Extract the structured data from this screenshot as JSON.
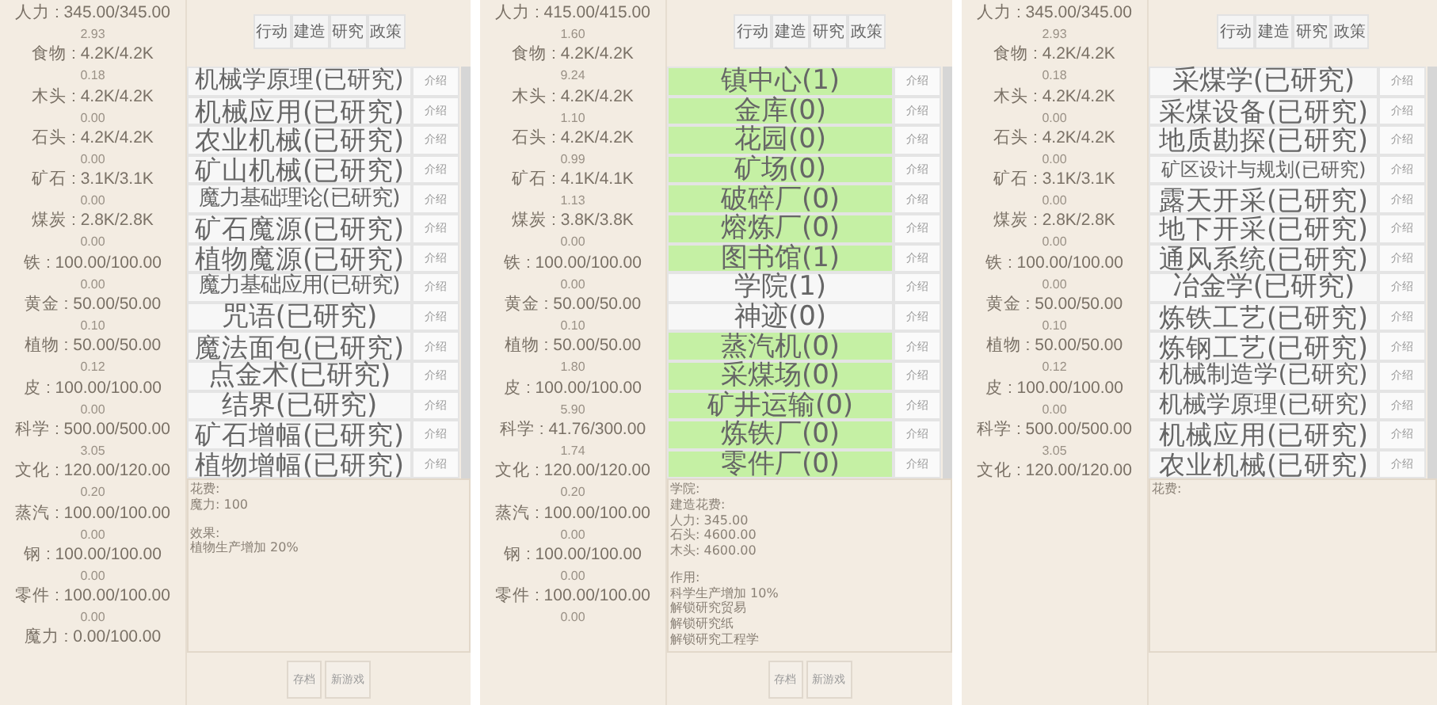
{
  "panels": [
    {
      "resources": [
        {
          "label": "人力 : 345.00/345.00",
          "rate": "2.93"
        },
        {
          "label": "食物 : 4.2K/4.2K",
          "rate": "0.18"
        },
        {
          "label": "木头 : 4.2K/4.2K",
          "rate": "0.00"
        },
        {
          "label": "石头 : 4.2K/4.2K",
          "rate": "0.00"
        },
        {
          "label": "矿石 : 3.1K/3.1K",
          "rate": "0.00"
        },
        {
          "label": "煤炭 : 2.8K/2.8K",
          "rate": "0.00"
        },
        {
          "label": "铁 : 100.00/100.00",
          "rate": "0.00"
        },
        {
          "label": "黄金 : 50.00/50.00",
          "rate": "0.10"
        },
        {
          "label": "植物 : 50.00/50.00",
          "rate": "0.12"
        },
        {
          "label": "皮 : 100.00/100.00",
          "rate": "0.00"
        },
        {
          "label": "科学 : 500.00/500.00",
          "rate": "3.05"
        },
        {
          "label": "文化 : 120.00/120.00",
          "rate": "0.20"
        },
        {
          "label": "蒸汽 : 100.00/100.00",
          "rate": "0.00"
        },
        {
          "label": "钢 : 100.00/100.00",
          "rate": "0.00"
        },
        {
          "label": "零件 : 100.00/100.00",
          "rate": "0.00"
        },
        {
          "label": "魔力 : 0.00/100.00"
        }
      ],
      "tabs": [
        "行动",
        "建造",
        "研究",
        "政策"
      ],
      "list": [
        {
          "name": "机械学原理(已研究)",
          "button": "介绍",
          "available": false
        },
        {
          "name": "机械应用(已研究)",
          "button": "介绍",
          "available": false
        },
        {
          "name": "农业机械(已研究)",
          "button": "介绍",
          "available": false
        },
        {
          "name": "矿山机械(已研究)",
          "button": "介绍",
          "available": false
        },
        {
          "name": "魔力基础理论(已研究)",
          "button": "介绍",
          "available": false
        },
        {
          "name": "矿石魔源(已研究)",
          "button": "介绍",
          "available": false
        },
        {
          "name": "植物魔源(已研究)",
          "button": "介绍",
          "available": false
        },
        {
          "name": "魔力基础应用(已研究)",
          "button": "介绍",
          "available": false
        },
        {
          "name": "咒语(已研究)",
          "button": "介绍",
          "available": false
        },
        {
          "name": "魔法面包(已研究)",
          "button": "介绍",
          "available": false
        },
        {
          "name": "点金术(已研究)",
          "button": "介绍",
          "available": false
        },
        {
          "name": "结界(已研究)",
          "button": "介绍",
          "available": false
        },
        {
          "name": "矿石增幅(已研究)",
          "button": "介绍",
          "available": false
        },
        {
          "name": "植物增幅(已研究)",
          "button": "介绍",
          "available": false
        }
      ],
      "details": [
        [
          "花费:",
          "魔力: 100"
        ],
        [
          "效果:",
          "植物生产增加 20%"
        ]
      ],
      "footer_buttons": [
        "存档",
        "新游戏"
      ]
    },
    {
      "resources": [
        {
          "label": "人力 : 415.00/415.00",
          "rate": "1.60"
        },
        {
          "label": "食物 : 4.2K/4.2K",
          "rate": "9.24"
        },
        {
          "label": "木头 : 4.2K/4.2K",
          "rate": "1.10"
        },
        {
          "label": "石头 : 4.2K/4.2K",
          "rate": "0.99"
        },
        {
          "label": "矿石 : 4.1K/4.1K",
          "rate": "1.13"
        },
        {
          "label": "煤炭 : 3.8K/3.8K",
          "rate": "0.00"
        },
        {
          "label": "铁 : 100.00/100.00",
          "rate": "0.00"
        },
        {
          "label": "黄金 : 50.00/50.00",
          "rate": "0.10"
        },
        {
          "label": "植物 : 50.00/50.00",
          "rate": "1.80"
        },
        {
          "label": "皮 : 100.00/100.00",
          "rate": "5.90"
        },
        {
          "label": "科学 : 41.76/300.00",
          "rate": "1.74"
        },
        {
          "label": "文化 : 120.00/120.00",
          "rate": "0.20"
        },
        {
          "label": "蒸汽 : 100.00/100.00",
          "rate": "0.00"
        },
        {
          "label": "钢 : 100.00/100.00",
          "rate": "0.00"
        },
        {
          "label": "零件 : 100.00/100.00",
          "rate": "0.00"
        }
      ],
      "tabs": [
        "行动",
        "建造",
        "研究",
        "政策"
      ],
      "list": [
        {
          "name": "镇中心(1)",
          "button": "介绍",
          "available": true
        },
        {
          "name": "金库(0)",
          "button": "介绍",
          "available": true
        },
        {
          "name": "花园(0)",
          "button": "介绍",
          "available": true
        },
        {
          "name": "矿场(0)",
          "button": "介绍",
          "available": true
        },
        {
          "name": "破碎厂(0)",
          "button": "介绍",
          "available": true
        },
        {
          "name": "熔炼厂(0)",
          "button": "介绍",
          "available": true
        },
        {
          "name": "图书馆(1)",
          "button": "介绍",
          "available": true
        },
        {
          "name": "学院(1)",
          "button": "介绍",
          "available": false
        },
        {
          "name": "神迹(0)",
          "button": "介绍",
          "available": false
        },
        {
          "name": "蒸汽机(0)",
          "button": "介绍",
          "available": true
        },
        {
          "name": "采煤场(0)",
          "button": "介绍",
          "available": true
        },
        {
          "name": "矿井运输(0)",
          "button": "介绍",
          "available": true
        },
        {
          "name": "炼铁厂(0)",
          "button": "介绍",
          "available": true
        },
        {
          "name": "零件厂(0)",
          "button": "介绍",
          "available": true
        }
      ],
      "details": [
        [
          "学院:",
          "建造花费:",
          "人力: 345.00",
          "石头: 4600.00",
          "木头: 4600.00"
        ],
        [
          "作用:",
          "科学生产增加 10%",
          "解锁研究贸易",
          "解锁研究纸",
          "解锁研究工程学"
        ]
      ],
      "footer_buttons": [
        "存档",
        "新游戏"
      ]
    },
    {
      "resources": [
        {
          "label": "人力 : 345.00/345.00",
          "rate": "2.93"
        },
        {
          "label": "食物 : 4.2K/4.2K",
          "rate": "0.18"
        },
        {
          "label": "木头 : 4.2K/4.2K",
          "rate": "0.00"
        },
        {
          "label": "石头 : 4.2K/4.2K",
          "rate": "0.00"
        },
        {
          "label": "矿石 : 3.1K/3.1K",
          "rate": "0.00"
        },
        {
          "label": "煤炭 : 2.8K/2.8K",
          "rate": "0.00"
        },
        {
          "label": "铁 : 100.00/100.00",
          "rate": "0.00"
        },
        {
          "label": "黄金 : 50.00/50.00",
          "rate": "0.10"
        },
        {
          "label": "植物 : 50.00/50.00",
          "rate": "0.12"
        },
        {
          "label": "皮 : 100.00/100.00",
          "rate": "0.00"
        },
        {
          "label": "科学 : 500.00/500.00",
          "rate": "3.05"
        },
        {
          "label": "文化 : 120.00/120.00"
        }
      ],
      "tabs": [
        "行动",
        "建造",
        "研究",
        "政策"
      ],
      "list": [
        {
          "name": "采煤学(已研究)",
          "button": "介绍",
          "available": false
        },
        {
          "name": "采煤设备(已研究)",
          "button": "介绍",
          "available": false
        },
        {
          "name": "地质勘探(已研究)",
          "button": "介绍",
          "available": false
        },
        {
          "name": "矿区设计与规划(已研究)",
          "button": "介绍",
          "available": false
        },
        {
          "name": "露天开采(已研究)",
          "button": "介绍",
          "available": false
        },
        {
          "name": "地下开采(已研究)",
          "button": "介绍",
          "available": false
        },
        {
          "name": "通风系统(已研究)",
          "button": "介绍",
          "available": false
        },
        {
          "name": "冶金学(已研究)",
          "button": "介绍",
          "available": false
        },
        {
          "name": "炼铁工艺(已研究)",
          "button": "介绍",
          "available": false
        },
        {
          "name": "炼钢工艺(已研究)",
          "button": "介绍",
          "available": false
        },
        {
          "name": "机械制造学(已研究)",
          "button": "介绍",
          "available": false
        },
        {
          "name": "机械学原理(已研究)",
          "button": "介绍",
          "available": false
        },
        {
          "name": "机械应用(已研究)",
          "button": "介绍",
          "available": false
        },
        {
          "name": "农业机械(已研究)",
          "button": "介绍",
          "available": false
        }
      ],
      "details": [
        [
          "花费:"
        ]
      ]
    }
  ]
}
